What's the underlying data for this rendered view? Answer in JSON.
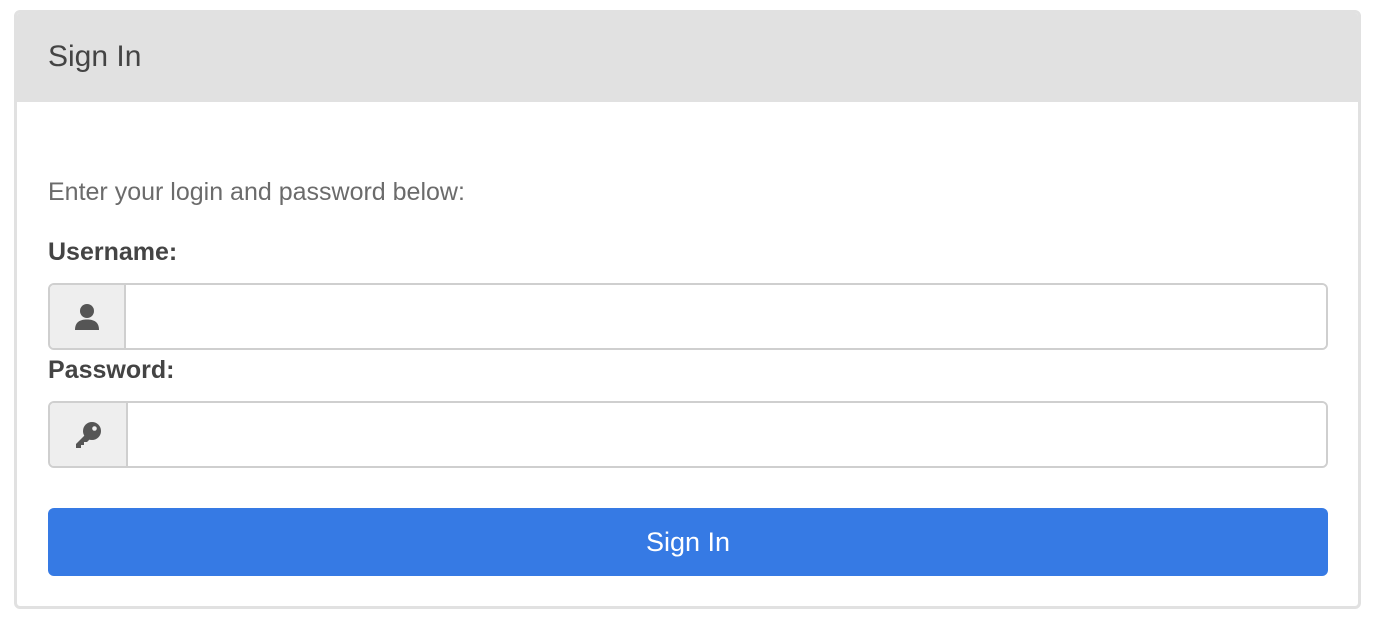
{
  "panel": {
    "title": "Sign In"
  },
  "form": {
    "instructions": "Enter your login and password below:",
    "username": {
      "label": "Username:",
      "value": "",
      "placeholder": "",
      "icon": "user-icon"
    },
    "password": {
      "label": "Password:",
      "value": "",
      "placeholder": "",
      "icon": "key-icon"
    },
    "submit_label": "Sign In"
  },
  "colors": {
    "header_bg": "#e1e1e1",
    "button_bg": "#367ae4",
    "icon": "#555555"
  }
}
